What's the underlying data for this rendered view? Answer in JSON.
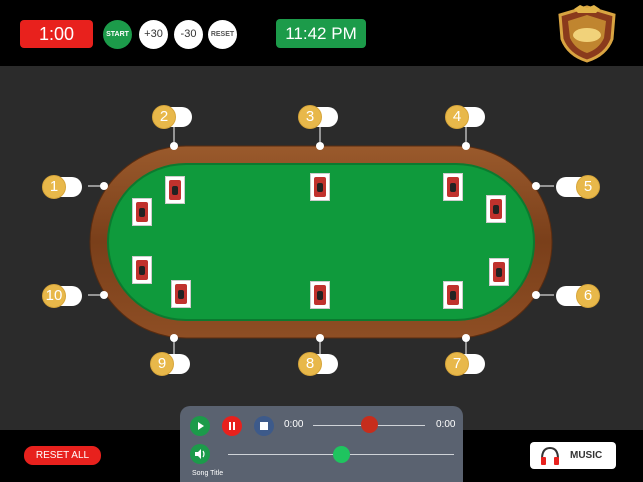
{
  "header": {
    "timer": "1:00",
    "start_label": "START",
    "plus_label": "+30",
    "minus_label": "-30",
    "reset_label": "RESET",
    "clock": "11:42 PM"
  },
  "seats": [
    "1",
    "2",
    "3",
    "4",
    "5",
    "6",
    "7",
    "8",
    "9",
    "10"
  ],
  "footer": {
    "reset_all_label": "RESET ALL",
    "music_label": "MUSIC"
  },
  "player": {
    "current_time": "0:00",
    "total_time": "0:00",
    "song_title": "Song Title",
    "progress": 0.5,
    "volume": 0.5
  },
  "colors": {
    "red": "#e8211d",
    "green": "#1c9b4a",
    "felt": "#0f9a3c",
    "wood": "#8a4b22",
    "seat_gold": "#e8b84a"
  },
  "icons": [
    "logo-shield-icon",
    "play-icon",
    "pause-icon",
    "stop-icon",
    "volume-icon",
    "headphones-icon",
    "card-back-icon"
  ]
}
